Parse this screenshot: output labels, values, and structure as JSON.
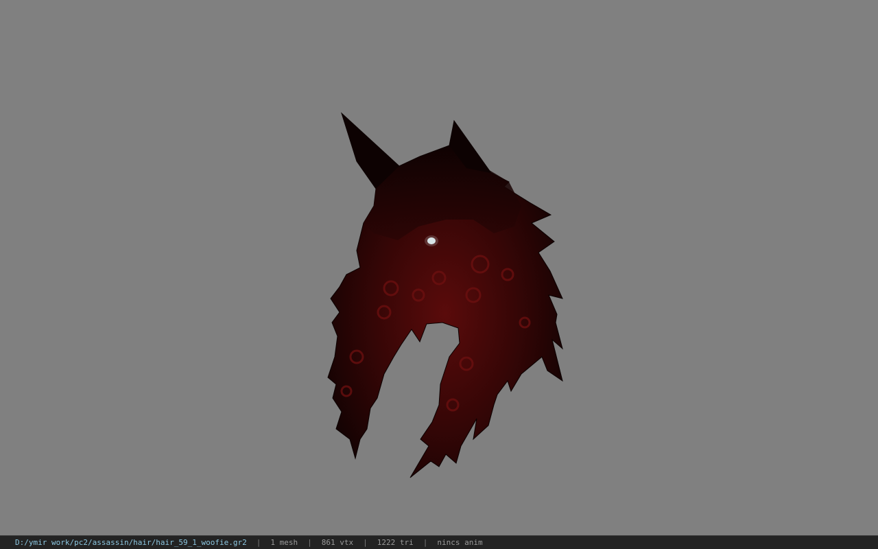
{
  "viewport": {
    "background": "#808080",
    "model": "hair-mesh",
    "colors": {
      "fur_dark": "#0e0202",
      "fur_red": "#5a0b0b",
      "eye": "#d8e4e8"
    }
  },
  "status_bar": {
    "file_path": "D:/ymir work/pc2/assassin/hair/hair_59_1_woofie.gr2",
    "separator": "|",
    "mesh_count": "1 mesh",
    "vertex_count": "861 vtx",
    "triangle_count": "1222 tri",
    "animation": "nincs anim",
    "path_color": "#8cc6e0"
  }
}
